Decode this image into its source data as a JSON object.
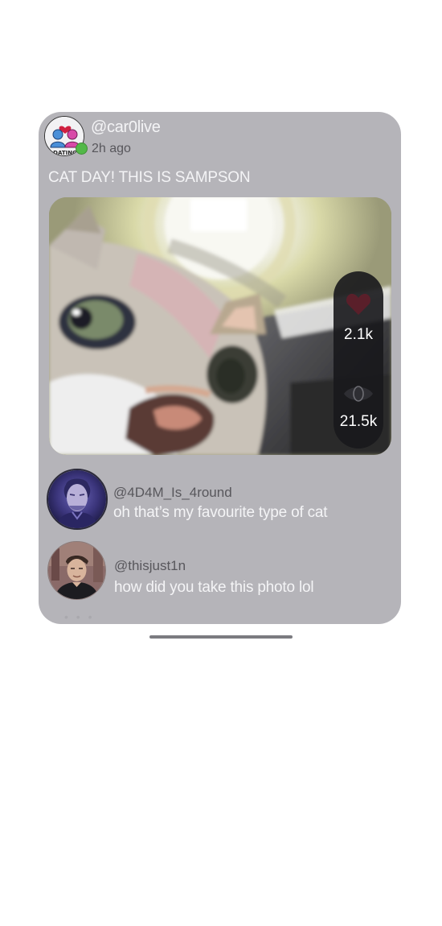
{
  "post": {
    "username": "@car0live",
    "time": "2h ago",
    "caption": "CAT DAY! THIS IS SAMPSON",
    "avatar_icon": "dating-app-logo-icon",
    "online_color": "#52b848",
    "likes": "2.1k",
    "views": "21.5k"
  },
  "comments": [
    {
      "handle": "@4D4M_Is_4round",
      "text": "oh that’s my favourite type of cat",
      "avatar_icon": "user-avatar"
    },
    {
      "handle": "@thisjust1n",
      "text": "how did you take this photo lol",
      "avatar_icon": "user-avatar"
    }
  ],
  "colors": {
    "card_background": "#b5b4b9",
    "heart": "#5a1f2a"
  }
}
